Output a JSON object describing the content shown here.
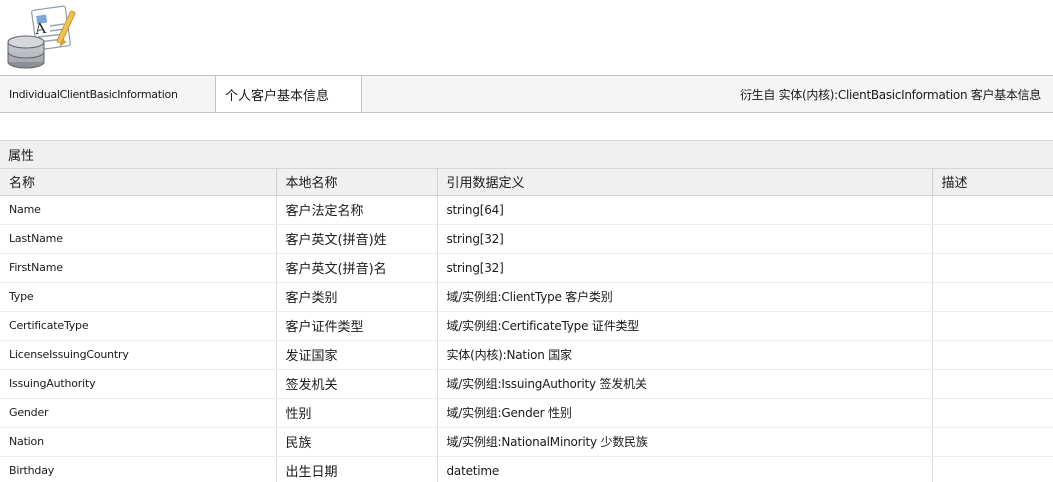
{
  "header": {
    "entity_name": "IndividualClientBasicInformation",
    "local_name": "个人客户基本信息",
    "derived_from": "衍生自 实体(内核):ClientBasicInformation 客户基本信息"
  },
  "properties": {
    "section_title": "属性",
    "columns": [
      "名称",
      "本地名称",
      "引用数据定义",
      "描述"
    ],
    "rows": [
      {
        "name": "Name",
        "local": "客户法定名称",
        "ref": "string[64]",
        "desc": ""
      },
      {
        "name": "LastName",
        "local": "客户英文(拼音)姓",
        "ref": "string[32]",
        "desc": ""
      },
      {
        "name": "FirstName",
        "local": "客户英文(拼音)名",
        "ref": "string[32]",
        "desc": ""
      },
      {
        "name": "Type",
        "local": "客户类别",
        "ref": "域/实例组:ClientType 客户类别",
        "desc": ""
      },
      {
        "name": "CertificateType",
        "local": "客户证件类型",
        "ref": "域/实例组:CertificateType 证件类型",
        "desc": ""
      },
      {
        "name": "LicenseIssuingCountry",
        "local": "发证国家",
        "ref": "实体(内核):Nation 国家",
        "desc": ""
      },
      {
        "name": "IssuingAuthority",
        "local": "签发机关",
        "ref": "域/实例组:IssuingAuthority 签发机关",
        "desc": ""
      },
      {
        "name": "Gender",
        "local": "性别",
        "ref": "域/实例组:Gender 性别",
        "desc": ""
      },
      {
        "name": "Nation",
        "local": "民族",
        "ref": "域/实例组:NationalMinority 少数民族",
        "desc": ""
      },
      {
        "name": "Birthday",
        "local": "出生日期",
        "ref": "datetime",
        "desc": ""
      }
    ]
  }
}
